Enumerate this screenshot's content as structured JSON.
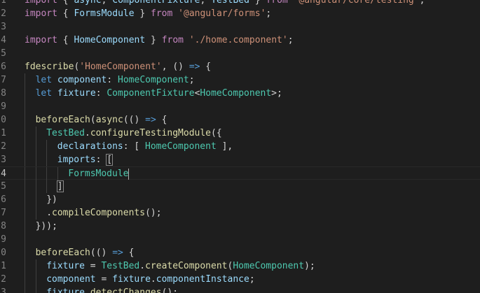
{
  "editor": {
    "lines": [
      {
        "num": "1",
        "indent": 0,
        "tokens": [
          [
            "kw",
            "import"
          ],
          [
            "punc",
            " { "
          ],
          [
            "var",
            "async"
          ],
          [
            "punc",
            ", "
          ],
          [
            "var",
            "ComponentFixture"
          ],
          [
            "punc",
            ", "
          ],
          [
            "var",
            "TestBed"
          ],
          [
            "punc",
            " } "
          ],
          [
            "kw",
            "from"
          ],
          [
            "punc",
            " "
          ],
          [
            "str",
            "'@angular/core/testing'"
          ],
          [
            "punc",
            ";"
          ]
        ]
      },
      {
        "num": "2",
        "indent": 0,
        "tokens": [
          [
            "kw",
            "import"
          ],
          [
            "punc",
            " { "
          ],
          [
            "var",
            "FormsModule"
          ],
          [
            "punc",
            " } "
          ],
          [
            "kw",
            "from"
          ],
          [
            "punc",
            " "
          ],
          [
            "str",
            "'@angular/forms'"
          ],
          [
            "punc",
            ";"
          ]
        ]
      },
      {
        "num": "3",
        "indent": 0,
        "tokens": []
      },
      {
        "num": "4",
        "indent": 0,
        "tokens": [
          [
            "kw",
            "import"
          ],
          [
            "punc",
            " { "
          ],
          [
            "var",
            "HomeComponent"
          ],
          [
            "punc",
            " } "
          ],
          [
            "kw",
            "from"
          ],
          [
            "punc",
            " "
          ],
          [
            "str",
            "'./home.component'"
          ],
          [
            "punc",
            ";"
          ]
        ]
      },
      {
        "num": "5",
        "indent": 0,
        "tokens": []
      },
      {
        "num": "6",
        "indent": 0,
        "tokens": [
          [
            "fn",
            "fdescribe"
          ],
          [
            "punc",
            "("
          ],
          [
            "str",
            "'HomeComponent'"
          ],
          [
            "punc",
            ", () "
          ],
          [
            "kw2",
            "=>"
          ],
          [
            "punc",
            " {"
          ]
        ]
      },
      {
        "num": "7",
        "indent": 1,
        "tokens": [
          [
            "kw2",
            "let"
          ],
          [
            "punc",
            " "
          ],
          [
            "var",
            "component"
          ],
          [
            "punc",
            ": "
          ],
          [
            "type",
            "HomeComponent"
          ],
          [
            "punc",
            ";"
          ]
        ]
      },
      {
        "num": "8",
        "indent": 1,
        "tokens": [
          [
            "kw2",
            "let"
          ],
          [
            "punc",
            " "
          ],
          [
            "var",
            "fixture"
          ],
          [
            "punc",
            ": "
          ],
          [
            "type",
            "ComponentFixture"
          ],
          [
            "punc",
            "<"
          ],
          [
            "type",
            "HomeComponent"
          ],
          [
            "punc",
            ">;"
          ]
        ]
      },
      {
        "num": "9",
        "indent": 1,
        "tokens": []
      },
      {
        "num": "0",
        "indent": 1,
        "tokens": [
          [
            "fn",
            "beforeEach"
          ],
          [
            "punc",
            "("
          ],
          [
            "fn",
            "async"
          ],
          [
            "punc",
            "(() "
          ],
          [
            "kw2",
            "=>"
          ],
          [
            "punc",
            " {"
          ]
        ]
      },
      {
        "num": "1",
        "indent": 2,
        "tokens": [
          [
            "type",
            "TestBed"
          ],
          [
            "punc",
            "."
          ],
          [
            "fn",
            "configureTestingModule"
          ],
          [
            "punc",
            "({"
          ]
        ]
      },
      {
        "num": "2",
        "indent": 3,
        "tokens": [
          [
            "var",
            "declarations"
          ],
          [
            "punc",
            ": [ "
          ],
          [
            "type",
            "HomeComponent"
          ],
          [
            "punc",
            " ],"
          ]
        ]
      },
      {
        "num": "3",
        "indent": 3,
        "tokens": [
          [
            "var",
            "imports"
          ],
          [
            "punc",
            ": "
          ],
          [
            "bracket",
            "["
          ]
        ]
      },
      {
        "num": "4",
        "indent": 4,
        "current": true,
        "tokens": [
          [
            "type",
            "FormsModule"
          ],
          [
            "cursor",
            ""
          ]
        ]
      },
      {
        "num": "5",
        "indent": 3,
        "tokens": [
          [
            "bracket",
            "]"
          ]
        ]
      },
      {
        "num": "6",
        "indent": 2,
        "tokens": [
          [
            "punc",
            "})"
          ]
        ]
      },
      {
        "num": "7",
        "indent": 2,
        "tokens": [
          [
            "punc",
            "."
          ],
          [
            "fn",
            "compileComponents"
          ],
          [
            "punc",
            "();"
          ]
        ]
      },
      {
        "num": "8",
        "indent": 1,
        "tokens": [
          [
            "punc",
            "}));"
          ]
        ]
      },
      {
        "num": "9",
        "indent": 1,
        "tokens": []
      },
      {
        "num": "0",
        "indent": 1,
        "tokens": [
          [
            "fn",
            "beforeEach"
          ],
          [
            "punc",
            "(() "
          ],
          [
            "kw2",
            "=>"
          ],
          [
            "punc",
            " {"
          ]
        ]
      },
      {
        "num": "1",
        "indent": 2,
        "tokens": [
          [
            "var",
            "fixture"
          ],
          [
            "punc",
            " = "
          ],
          [
            "type",
            "TestBed"
          ],
          [
            "punc",
            "."
          ],
          [
            "fn",
            "createComponent"
          ],
          [
            "punc",
            "("
          ],
          [
            "type",
            "HomeComponent"
          ],
          [
            "punc",
            ");"
          ]
        ]
      },
      {
        "num": "2",
        "indent": 2,
        "tokens": [
          [
            "var",
            "component"
          ],
          [
            "punc",
            " = "
          ],
          [
            "var",
            "fixture"
          ],
          [
            "punc",
            "."
          ],
          [
            "var",
            "componentInstance"
          ],
          [
            "punc",
            ";"
          ]
        ]
      },
      {
        "num": "3",
        "indent": 2,
        "tokens": [
          [
            "var",
            "fixture"
          ],
          [
            "punc",
            "."
          ],
          [
            "fn",
            "detectChanges"
          ],
          [
            "punc",
            "();"
          ]
        ]
      }
    ]
  },
  "colors": {
    "background": "#1e1e1e",
    "keyword_control": "#c586c0",
    "keyword_storage": "#569cd6",
    "variable": "#9cdcfe",
    "type": "#4ec9b0",
    "string": "#ce9178",
    "function": "#dcdcaa",
    "line_number": "#858585"
  }
}
